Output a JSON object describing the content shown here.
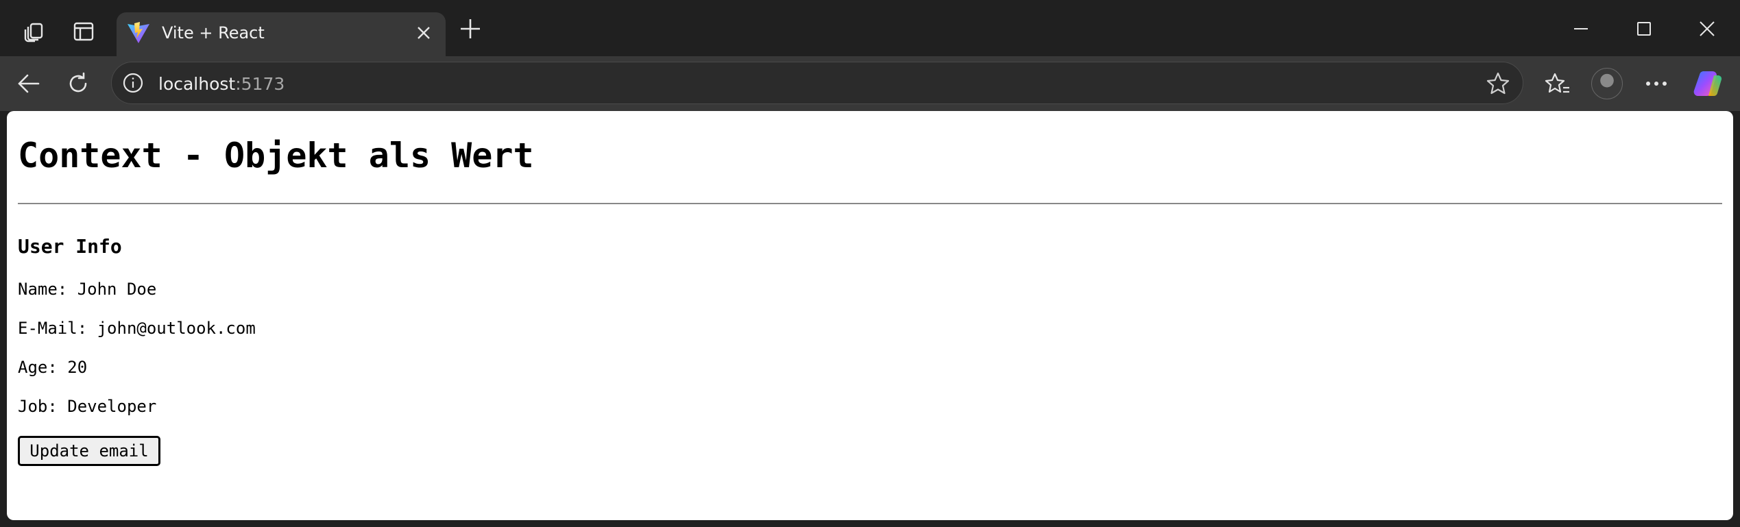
{
  "browser": {
    "tab": {
      "title": "Vite + React",
      "favicon": "vite-logo-icon"
    },
    "address_bar": {
      "host": "localhost",
      "port": ":5173"
    },
    "icons": {
      "workspaces": "workspaces-icon",
      "tab_actions": "tab-actions-icon",
      "new_tab": "plus-icon",
      "minimize": "minimize-icon",
      "maximize": "maximize-icon",
      "close": "close-icon",
      "back": "back-arrow-icon",
      "refresh": "refresh-icon",
      "info": "info-icon",
      "favorite": "star-icon",
      "favorites": "favorites-icon",
      "profile": "avatar",
      "more": "more-icon",
      "copilot": "copilot-icon"
    },
    "colors": {
      "titlebar": "#202020",
      "toolbar": "#383838",
      "page_background": "#ffffff"
    }
  },
  "page": {
    "heading": "Context - Objekt als Wert",
    "section_title": "User Info",
    "info": [
      "Name: John Doe",
      "E-Mail: john@outlook.com",
      "Age: 20",
      "Job: Developer"
    ],
    "update_button": "Update email"
  }
}
